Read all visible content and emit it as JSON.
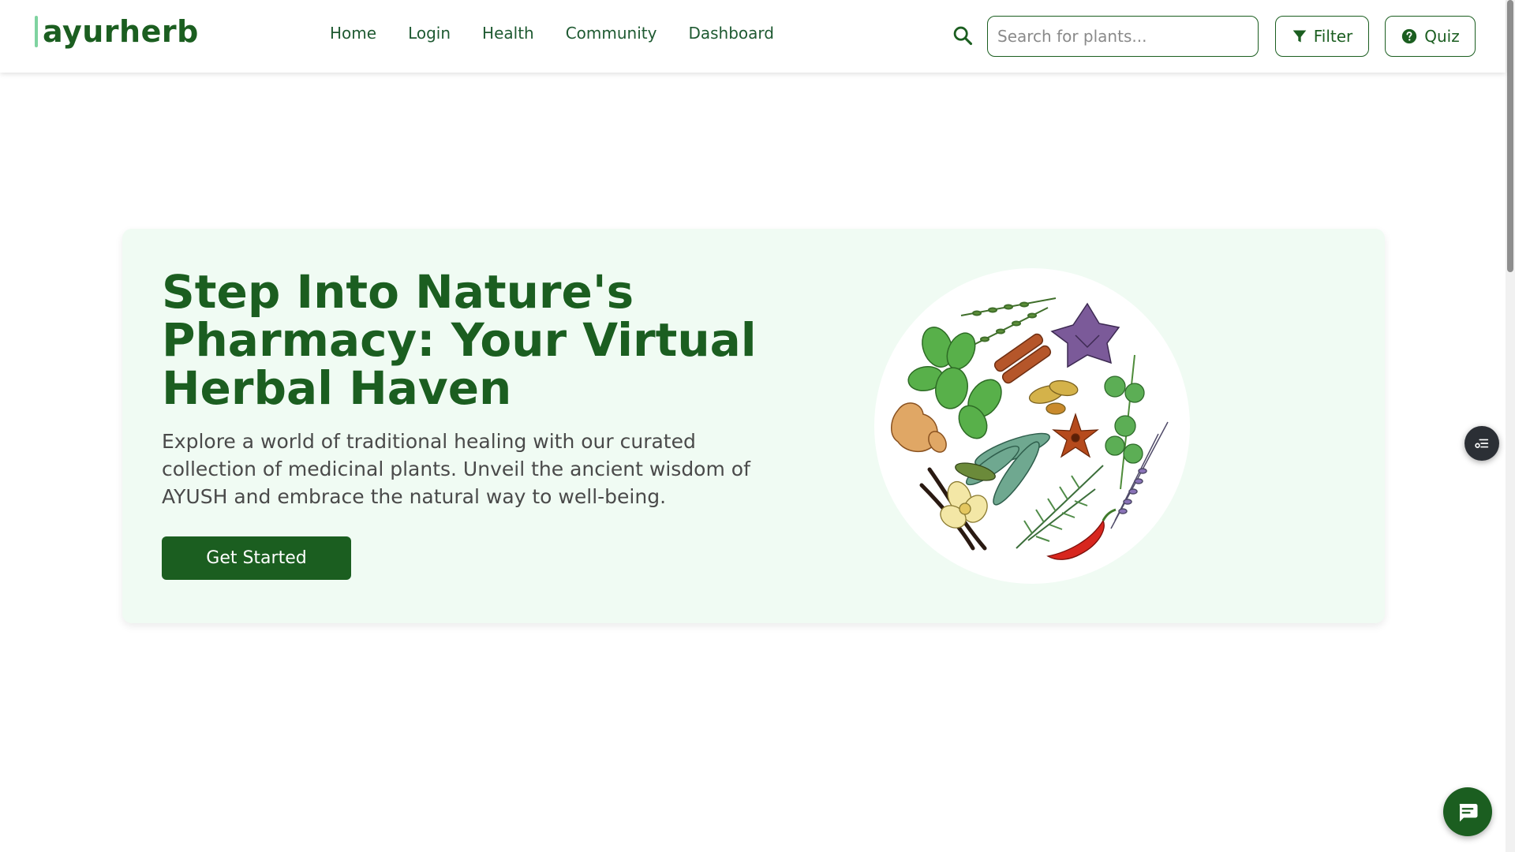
{
  "brand": {
    "name": "ayurherb"
  },
  "nav": {
    "items": [
      {
        "label": "Home"
      },
      {
        "label": "Login"
      },
      {
        "label": "Health"
      },
      {
        "label": "Community"
      },
      {
        "label": "Dashboard"
      }
    ]
  },
  "search": {
    "placeholder": "Search for plants...",
    "value": ""
  },
  "header_buttons": {
    "filter_label": "Filter",
    "quiz_label": "Quiz"
  },
  "hero": {
    "title": "Step Into Nature's Pharmacy: Your Virtual Herbal Haven",
    "description": "Explore a world of traditional healing with our curated collection of medicinal plants. Unveil the ancient wisdom of AYUSH and embrace the natural way to well-being.",
    "cta_label": "Get Started"
  },
  "colors": {
    "primary": "#1b5e20",
    "hero_bg": "#f0fbf3",
    "logo_accent": "#7fd3a0",
    "text_muted": "#4a4a4a"
  },
  "icons": {
    "search": "search-icon",
    "filter": "filter-icon",
    "quiz": "help-circle-icon",
    "side_float": "settings-list-icon",
    "chat": "chat-icon"
  }
}
